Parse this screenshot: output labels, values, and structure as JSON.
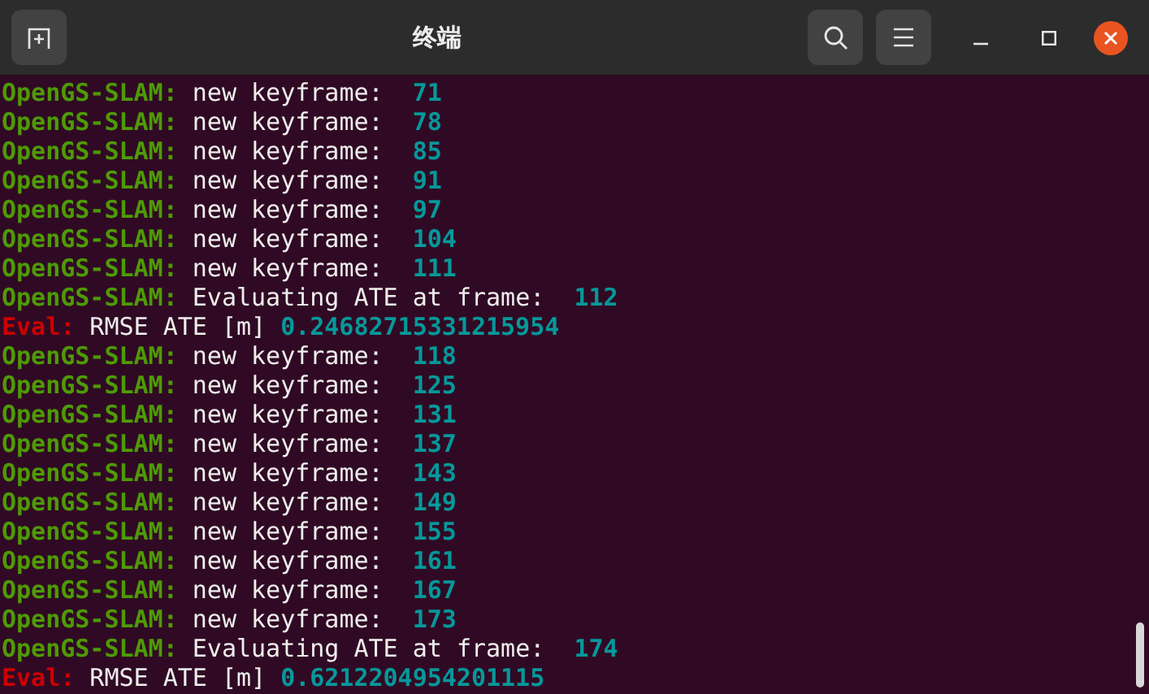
{
  "window": {
    "title": "终端"
  },
  "lines": [
    {
      "kind": "slam",
      "prefix": "OpenGS-SLAM:",
      "message": "new keyframe:",
      "value": "71"
    },
    {
      "kind": "slam",
      "prefix": "OpenGS-SLAM:",
      "message": "new keyframe:",
      "value": "78"
    },
    {
      "kind": "slam",
      "prefix": "OpenGS-SLAM:",
      "message": "new keyframe:",
      "value": "85"
    },
    {
      "kind": "slam",
      "prefix": "OpenGS-SLAM:",
      "message": "new keyframe:",
      "value": "91"
    },
    {
      "kind": "slam",
      "prefix": "OpenGS-SLAM:",
      "message": "new keyframe:",
      "value": "97"
    },
    {
      "kind": "slam",
      "prefix": "OpenGS-SLAM:",
      "message": "new keyframe:",
      "value": "104"
    },
    {
      "kind": "slam",
      "prefix": "OpenGS-SLAM:",
      "message": "new keyframe:",
      "value": "111"
    },
    {
      "kind": "slam",
      "prefix": "OpenGS-SLAM:",
      "message": "Evaluating ATE at frame:",
      "value": "112"
    },
    {
      "kind": "eval",
      "prefix": "Eval:",
      "message": "RMSE ATE [m]",
      "value": "0.24682715331215954"
    },
    {
      "kind": "slam",
      "prefix": "OpenGS-SLAM:",
      "message": "new keyframe:",
      "value": "118"
    },
    {
      "kind": "slam",
      "prefix": "OpenGS-SLAM:",
      "message": "new keyframe:",
      "value": "125"
    },
    {
      "kind": "slam",
      "prefix": "OpenGS-SLAM:",
      "message": "new keyframe:",
      "value": "131"
    },
    {
      "kind": "slam",
      "prefix": "OpenGS-SLAM:",
      "message": "new keyframe:",
      "value": "137"
    },
    {
      "kind": "slam",
      "prefix": "OpenGS-SLAM:",
      "message": "new keyframe:",
      "value": "143"
    },
    {
      "kind": "slam",
      "prefix": "OpenGS-SLAM:",
      "message": "new keyframe:",
      "value": "149"
    },
    {
      "kind": "slam",
      "prefix": "OpenGS-SLAM:",
      "message": "new keyframe:",
      "value": "155"
    },
    {
      "kind": "slam",
      "prefix": "OpenGS-SLAM:",
      "message": "new keyframe:",
      "value": "161"
    },
    {
      "kind": "slam",
      "prefix": "OpenGS-SLAM:",
      "message": "new keyframe:",
      "value": "167"
    },
    {
      "kind": "slam",
      "prefix": "OpenGS-SLAM:",
      "message": "new keyframe:",
      "value": "173"
    },
    {
      "kind": "slam",
      "prefix": "OpenGS-SLAM:",
      "message": "Evaluating ATE at frame:",
      "value": "174"
    },
    {
      "kind": "eval",
      "prefix": "Eval:",
      "message": "RMSE ATE [m]",
      "value": "0.6212204954201115"
    }
  ]
}
